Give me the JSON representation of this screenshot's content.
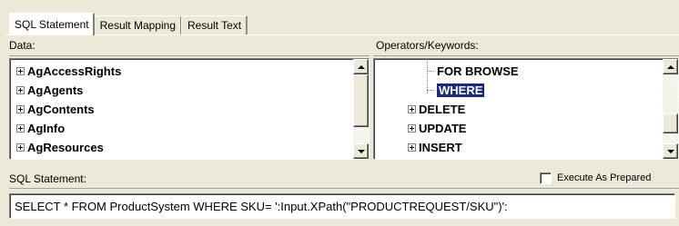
{
  "tabs": [
    {
      "label": "SQL Statement",
      "active": true
    },
    {
      "label": "Result Mapping",
      "active": false
    },
    {
      "label": "Result Text",
      "active": false
    }
  ],
  "data_panel": {
    "label": "Data:",
    "items": [
      "AgAccessRights",
      "AgAgents",
      "AgContents",
      "AgInfo",
      "AgResources"
    ]
  },
  "operators_panel": {
    "label": "Operators/Keywords:",
    "items": [
      {
        "label": "FOR BROWSE",
        "child": true
      },
      {
        "label": "WHERE",
        "child": true,
        "selected": true
      },
      {
        "label": "DELETE",
        "child": false
      },
      {
        "label": "UPDATE",
        "child": false
      },
      {
        "label": "INSERT",
        "child": false
      }
    ]
  },
  "statement": {
    "label": "SQL Statement:",
    "execute_as_prepared_label": "Execute As Prepared",
    "execute_as_prepared_checked": false,
    "value": "SELECT * FROM  ProductSystem  WHERE  SKU= ':Input.XPath(\"PRODUCTREQUEST/SKU\")':"
  },
  "colors": {
    "selection": "#1a2a80",
    "window": "#ece9d8"
  }
}
